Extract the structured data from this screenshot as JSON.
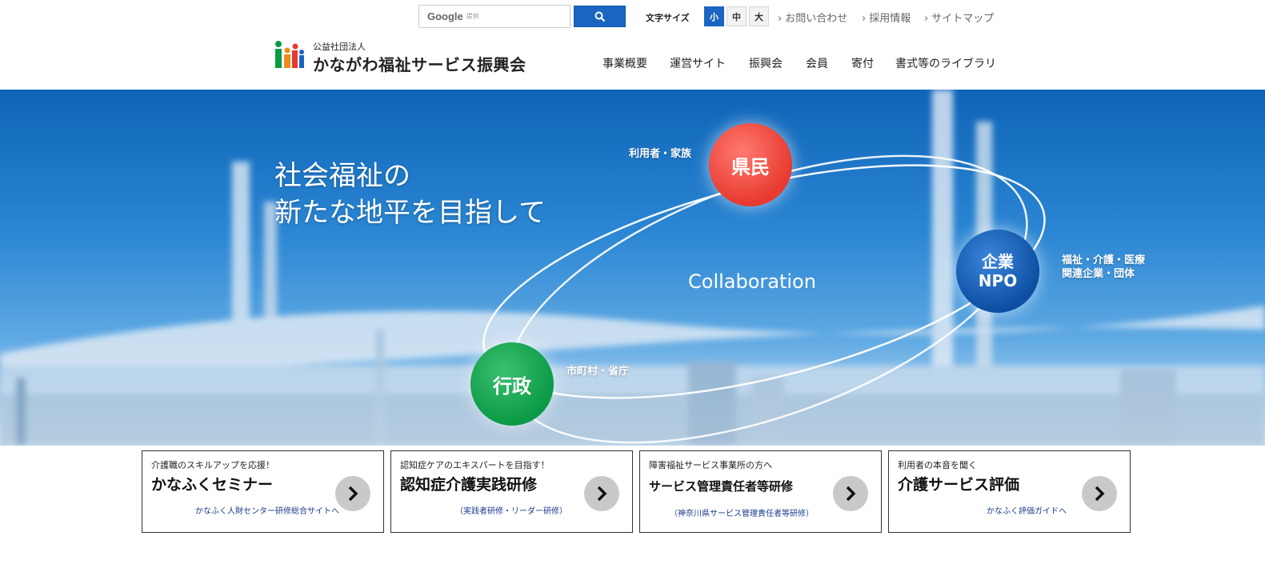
{
  "search": {
    "brand": "Google",
    "provided_by": "提供"
  },
  "font_size": {
    "label": "文字サイズ",
    "options": [
      "小",
      "中",
      "大"
    ],
    "selected": "小"
  },
  "util_links": [
    "お問い合わせ",
    "採用情報",
    "サイトマップ"
  ],
  "logo": {
    "subtitle": "公益社団法人",
    "name": "かながわ福祉サービス振興会"
  },
  "nav": [
    "事業概要",
    "運営サイト",
    "振興会",
    "会員",
    "寄付",
    "書式等のライブラリ"
  ],
  "hero": {
    "tagline_line1": "社会福祉の",
    "tagline_line2": "新たな地平を目指して",
    "collaboration": "Collaboration",
    "red_circle": "県民",
    "red_label": "利用者・家族",
    "blue_circle_line1": "企業",
    "blue_circle_line2": "NPO",
    "blue_label_line1": "福祉・介護・医療",
    "blue_label_line2": "関連企業・団体",
    "green_circle": "行政",
    "green_label": "市町村・省庁"
  },
  "cards": [
    {
      "kicker": "介護職のスキルアップを応援！",
      "title": "かなふくセミナー",
      "sub": "かなふく人財センター研修総合サイトへ"
    },
    {
      "kicker": "認知症ケアのエキスパートを目指す！",
      "title": "認知症介護実践研修",
      "sub": "（実践者研修・リーダー研修）"
    },
    {
      "kicker": "障害福祉サービス事業所の方へ",
      "title": "サービス管理責任者等研修",
      "sub": "（神奈川県サービス管理責任者等研修）"
    },
    {
      "kicker": "利用者の本音を聞く",
      "title": "介護サービス評価",
      "sub": "かなふく評価ガイドへ"
    }
  ],
  "colors": {
    "accent_blue": "#1a65c2",
    "red": "#e83a2f",
    "blue": "#0d4fa3",
    "green": "#0b9a45"
  }
}
